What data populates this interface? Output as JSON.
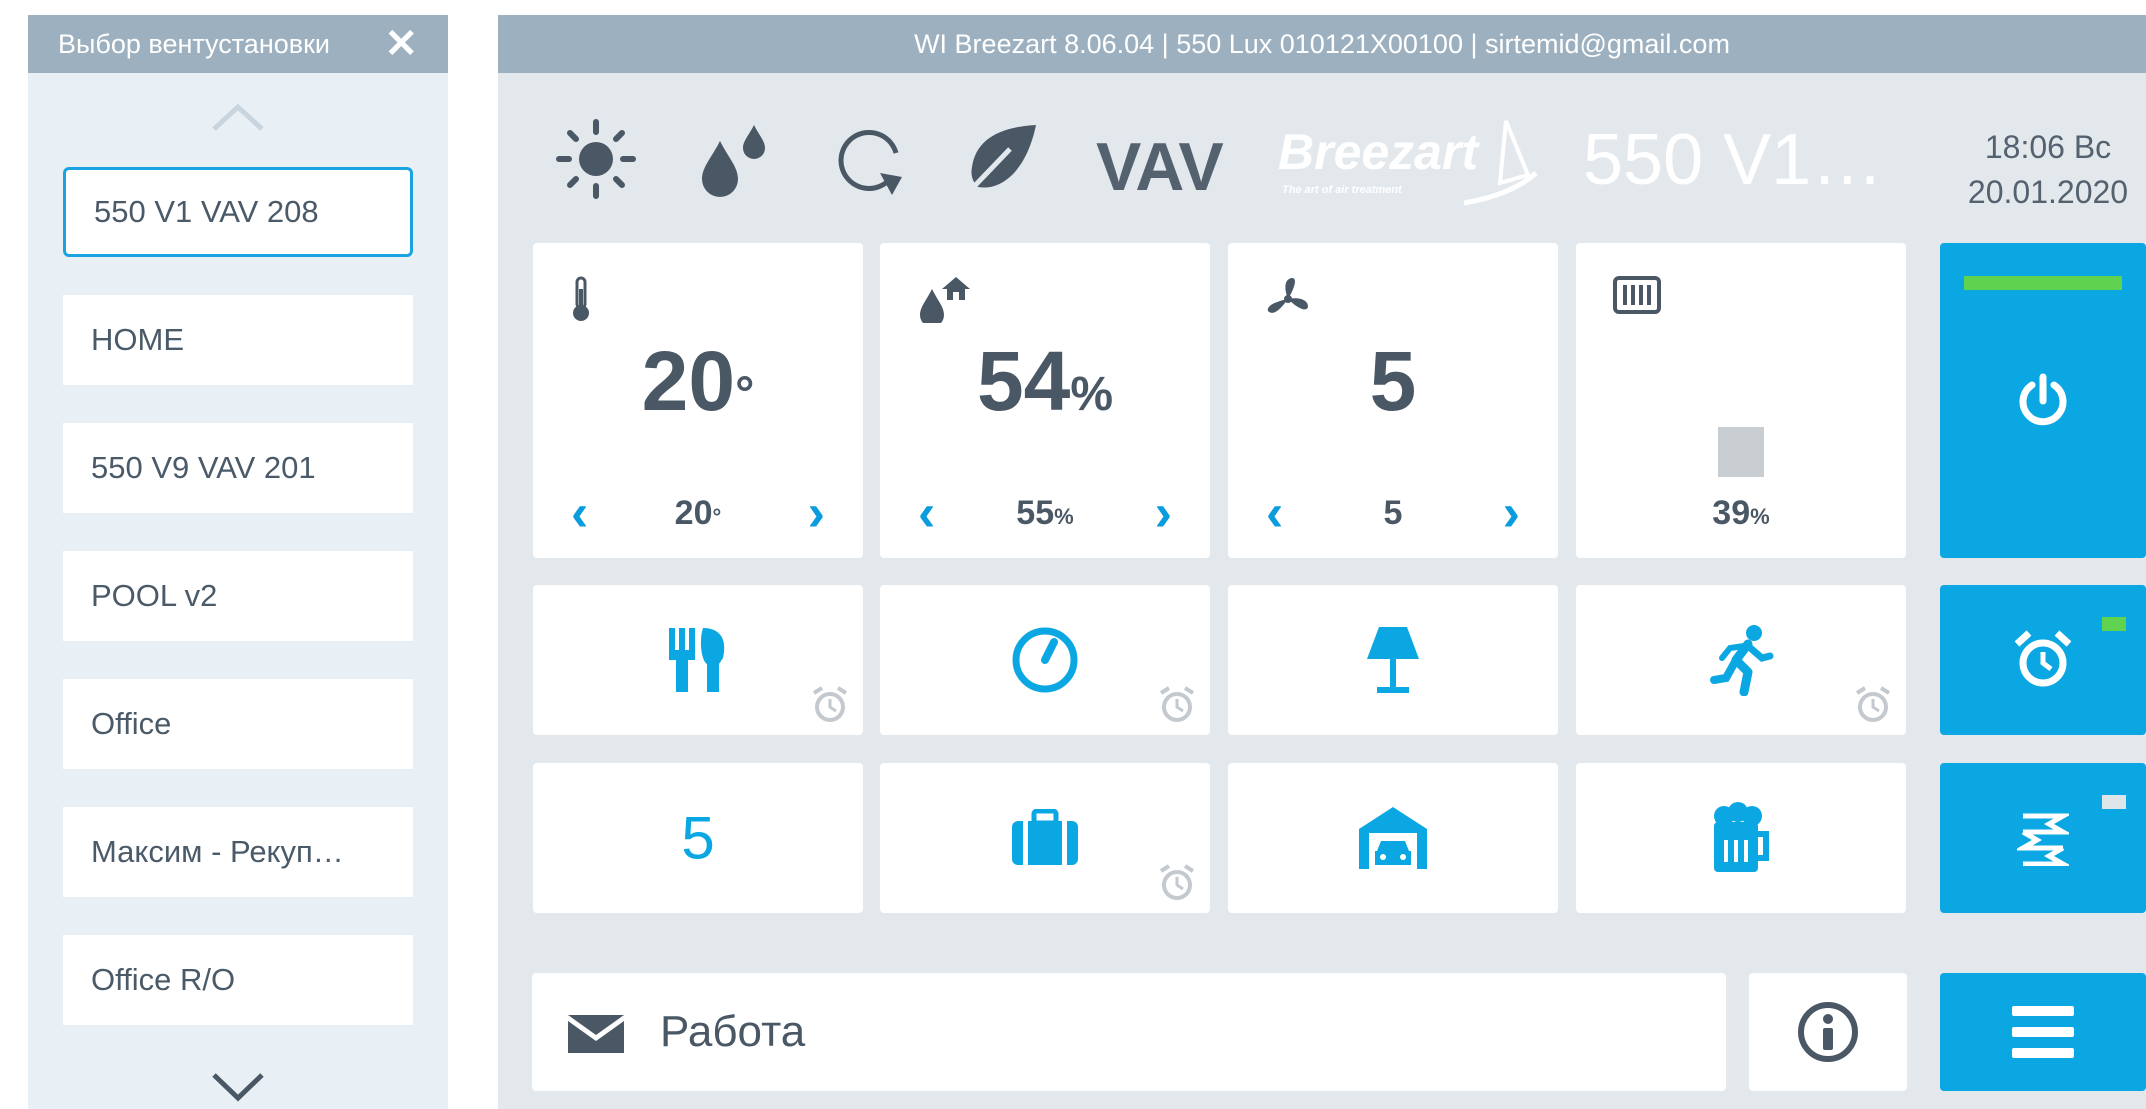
{
  "sidebar": {
    "title": "Выбор вентустановки",
    "items": [
      {
        "label": "550 V1 VAV 208",
        "selected": true
      },
      {
        "label": "HOME"
      },
      {
        "label": "550 V9 VAV 201"
      },
      {
        "label": "POOL v2"
      },
      {
        "label": "Office"
      },
      {
        "label": "Максим - Рекуп…"
      },
      {
        "label": "Office R/O"
      }
    ]
  },
  "header": {
    "title": "WI Breezart 8.06.04 | 550 Lux 010121X00100 | sirtemid@gmail.com"
  },
  "status": {
    "mode_text": "VAV",
    "unit_name": "550 V1…",
    "time": "18:06 Вс",
    "date": "20.01.2020",
    "icons": [
      "sun-icon",
      "humidity-drops-icon",
      "recirculation-icon",
      "leaf-icon",
      "breezart-logo"
    ]
  },
  "logo": {
    "brand": "Breezart",
    "tagline": "The art of air treatment"
  },
  "tiles": {
    "temperature": {
      "value": "20",
      "unit": "°",
      "setpoint": "20",
      "setpoint_unit": "°",
      "icon": "thermometer-icon"
    },
    "humidity": {
      "value": "54",
      "unit": "%",
      "setpoint": "55",
      "setpoint_unit": "%",
      "icon": "humidity-home-icon"
    },
    "fan": {
      "value": "5",
      "setpoint": "5",
      "icon": "fan-icon"
    },
    "heater": {
      "level_percent": 39,
      "label": "39",
      "unit": "%",
      "icon": "heater-icon"
    }
  },
  "modes": {
    "row1": [
      "dining-icon",
      "timer-icon",
      "lamp-icon",
      "running-icon"
    ],
    "row2_value": "5",
    "row2": [
      "briefcase-icon",
      "garage-icon",
      "beer-mug-icon"
    ]
  },
  "message": {
    "text": "Работа"
  },
  "colors": {
    "accent": "#0aa7e2",
    "header": "#9db0bf",
    "background": "#e3e8ed",
    "indicator_green": "#5fd34f"
  }
}
